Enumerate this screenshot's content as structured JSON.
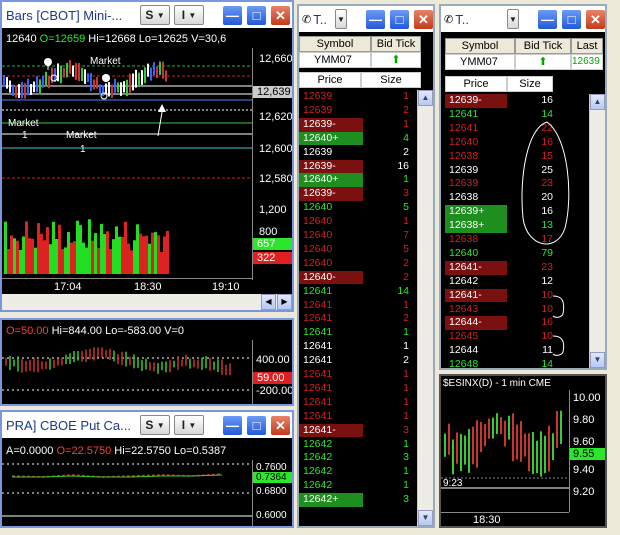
{
  "win1": {
    "title": "Bars [CBOT] Mini-...",
    "s_label": "S",
    "i_label": "I",
    "info": {
      "last": "12640",
      "open": "O=12659",
      "high": "Hi=12668",
      "low": "Lo=12625",
      "vol": "V=30,6"
    },
    "price_axis": [
      "12,660",
      "12,639",
      "12,620",
      "12,600",
      "12,580",
      "1,200",
      "800",
      "657",
      "322"
    ],
    "time_axis": [
      "17:04",
      "18:30",
      "19:10"
    ],
    "annotations": [
      "Market",
      "Market",
      "1",
      "Market",
      "1"
    ]
  },
  "win2": {
    "info": {
      "o": "O=50.00",
      "hi": "Hi=844.00",
      "lo": "Lo=-583.00",
      "v": "V=0"
    },
    "axis": [
      "400.00",
      "59.00",
      "-200.00"
    ]
  },
  "win3": {
    "title": "PRA] CBOE Put Ca...",
    "s_label": "S",
    "i_label": "I",
    "info": {
      "a": "A=0.0000",
      "o": "O=22.5750",
      "hi": "Hi=22.5750",
      "lo": "Lo=0.5387"
    },
    "axis": [
      "0.7600",
      "0.7364",
      "0.6800",
      "0.6000"
    ]
  },
  "dom1": {
    "title": "T..",
    "headers": {
      "symbol": "Symbol",
      "bid_tick": "Bid Tick",
      "price": "Price",
      "size": "Size"
    },
    "symbol": "YMM07",
    "rows": [
      {
        "p": "12639",
        "s": "1",
        "c": "ask"
      },
      {
        "p": "12639",
        "s": "2",
        "c": "ask"
      },
      {
        "p": "12639-",
        "s": "1",
        "c": "askb"
      },
      {
        "p": "12640+",
        "s": "4",
        "c": "bidb"
      },
      {
        "p": "12639",
        "s": "2",
        "c": "w"
      },
      {
        "p": "12639-",
        "s": "16",
        "c": "askbw"
      },
      {
        "p": "12640+",
        "s": "1",
        "c": "bidb"
      },
      {
        "p": "12639-",
        "s": "3",
        "c": "askb"
      },
      {
        "p": "12640",
        "s": "5",
        "c": "bid"
      },
      {
        "p": "12640",
        "s": "1",
        "c": "ask"
      },
      {
        "p": "12640",
        "s": "7",
        "c": "ask"
      },
      {
        "p": "12640",
        "s": "5",
        "c": "ask"
      },
      {
        "p": "12640",
        "s": "2",
        "c": "ask"
      },
      {
        "p": "12640-",
        "s": "2",
        "c": "askb"
      },
      {
        "p": "12641",
        "s": "14",
        "c": "bid"
      },
      {
        "p": "12641",
        "s": "1",
        "c": "ask"
      },
      {
        "p": "12641",
        "s": "2",
        "c": "ask"
      },
      {
        "p": "12641",
        "s": "1",
        "c": "bid"
      },
      {
        "p": "12641",
        "s": "1",
        "c": "w"
      },
      {
        "p": "12641",
        "s": "2",
        "c": "w"
      },
      {
        "p": "12641",
        "s": "1",
        "c": "ask"
      },
      {
        "p": "12641",
        "s": "1",
        "c": "ask"
      },
      {
        "p": "12641",
        "s": "1",
        "c": "ask"
      },
      {
        "p": "12641",
        "s": "1",
        "c": "ask"
      },
      {
        "p": "12641-",
        "s": "3",
        "c": "askb"
      },
      {
        "p": "12642",
        "s": "1",
        "c": "bid"
      },
      {
        "p": "12642",
        "s": "3",
        "c": "bid"
      },
      {
        "p": "12642",
        "s": "1",
        "c": "bid"
      },
      {
        "p": "12642",
        "s": "1",
        "c": "bid"
      },
      {
        "p": "12642+",
        "s": "3",
        "c": "bidb"
      }
    ]
  },
  "dom2": {
    "title": "T..",
    "headers": {
      "symbol": "Symbol",
      "bid_tick": "Bid Tick",
      "last": "Last",
      "price": "Price",
      "size": "Size"
    },
    "symbol": "YMM07",
    "last": "12639",
    "rows": [
      {
        "p": "12639-",
        "s": "16",
        "c": "askbw"
      },
      {
        "p": "12641",
        "s": "14",
        "c": "bid"
      },
      {
        "p": "12641",
        "s": "22",
        "c": "ask"
      },
      {
        "p": "12640",
        "s": "16",
        "c": "ask"
      },
      {
        "p": "12638",
        "s": "15",
        "c": "ask"
      },
      {
        "p": "12639",
        "s": "25",
        "c": "w"
      },
      {
        "p": "12639",
        "s": "23",
        "c": "ask"
      },
      {
        "p": "12638",
        "s": "20",
        "c": "w"
      },
      {
        "p": "12639+",
        "s": "16",
        "c": "bidbw"
      },
      {
        "p": "12638+",
        "s": "13",
        "c": "bidb"
      },
      {
        "p": "12638",
        "s": "17",
        "c": "ask"
      },
      {
        "p": "12640",
        "s": "79",
        "c": "bid"
      },
      {
        "p": "12641-",
        "s": "23",
        "c": "askb"
      },
      {
        "p": "12642",
        "s": "12",
        "c": "w"
      },
      {
        "p": "12641-",
        "s": "10",
        "c": "askb"
      },
      {
        "p": "12643",
        "s": "10",
        "c": "ask"
      },
      {
        "p": "12644-",
        "s": "16",
        "c": "askb"
      },
      {
        "p": "12645",
        "s": "10",
        "c": "ask"
      },
      {
        "p": "12644",
        "s": "11",
        "c": "w"
      },
      {
        "p": "12648",
        "s": "14",
        "c": "bid"
      }
    ]
  },
  "esinx": {
    "title": "$ESINX(D) - 1 min  CME",
    "axis": [
      "10.00",
      "9.80",
      "9.60",
      "9.55",
      "9.40",
      "9.20"
    ],
    "time": "18:30",
    "label": "9:23"
  },
  "colors": {
    "accent": "#2558D8",
    "bid": "#1E9E1E",
    "ask": "#8B1010"
  }
}
